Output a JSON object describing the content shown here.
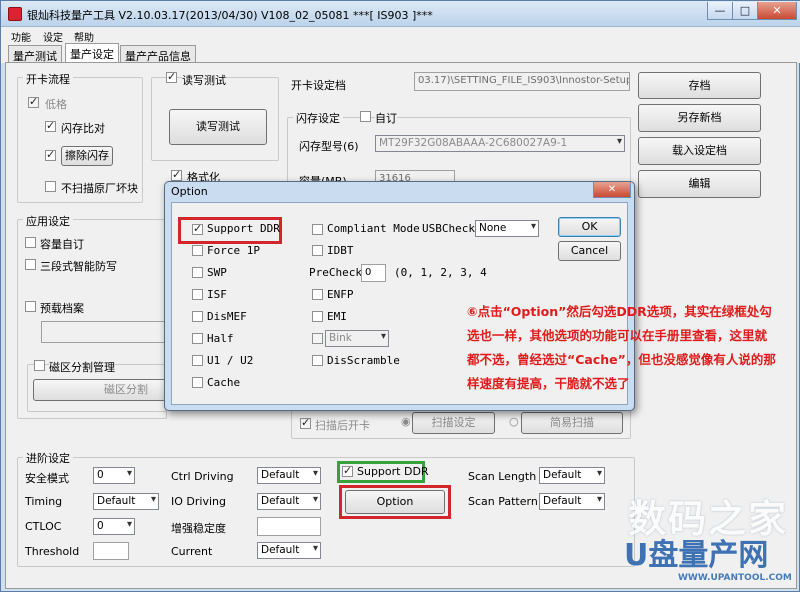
{
  "window": {
    "title": "银灿科技量产工具 V2.10.03.17(2013/04/30)    V108_02_05081              ***[ IS903 ]***",
    "min": "—",
    "max": "□",
    "close": "✕"
  },
  "menu": [
    "功能",
    "设定",
    "帮助"
  ],
  "tabs": [
    "量产测试",
    "量产设定",
    "量产产品信息"
  ],
  "card_flow": {
    "title": "开卡流程",
    "low_format": "低格",
    "flash_compare": "闪存比对",
    "erase_flash": "擦除闪存",
    "no_scan_bad": "不扫描原厂坏块"
  },
  "rw_test": {
    "title": "读写测试",
    "button": "读写测试"
  },
  "format": {
    "title": "格式化"
  },
  "settings_file": {
    "label": "开卡设定档",
    "value": "03.17)\\SETTING_FILE_IS903\\Innostor-Setup.ini"
  },
  "right_buttons": [
    "存档",
    "另存新档",
    "载入设定档",
    "编辑"
  ],
  "flash_settings": {
    "title": "闪存设定",
    "custom": "自订",
    "model_label": "闪存型号(6)",
    "model_value": "MT29F32G08ABAAA-2C680027A9-1",
    "capacity_label": "容量(MB)",
    "capacity_value": "31616"
  },
  "app_settings": {
    "title": "应用设定",
    "capacity_custom": "容量自订",
    "three_stage": "三段式智能防写",
    "preload": "预载档案",
    "partition_title": "磁区分割管理",
    "partition_button": "磁区分割"
  },
  "scan": {
    "scan_after": "扫描后开卡",
    "scan_settings": "扫描设定",
    "simple_scan": "简易扫描"
  },
  "advanced": {
    "title": "进阶设定",
    "safe_mode": {
      "label": "安全模式",
      "value": "0"
    },
    "timing": {
      "label": "Timing",
      "value": "Default"
    },
    "ctloc": {
      "label": "CTLOC",
      "value": "0"
    },
    "threshold": {
      "label": "Threshold",
      "value": ""
    },
    "ctrl_driving": {
      "label": "Ctrl Driving",
      "value": "Default"
    },
    "io_driving": {
      "label": "IO Driving",
      "value": "Default"
    },
    "stability": {
      "label": "增强稳定度",
      "value": ""
    },
    "current": {
      "label": "Current",
      "value": "Default"
    },
    "support_ddr": "Support DDR",
    "option_button": "Option",
    "scan_length": {
      "label": "Scan Length",
      "value": "Default"
    },
    "scan_pattern": {
      "label": "Scan Pattern",
      "value": "Default"
    }
  },
  "dialog": {
    "title": "Option",
    "close": "✕",
    "col1": [
      "Support DDR",
      "Force 1P",
      "SWP",
      "ISF",
      "DisMEF",
      "Half",
      "U1 / U2",
      "Cache"
    ],
    "compliant_mode": "Compliant Mode",
    "usbcheck_label": "USBCheck",
    "usbcheck_value": "None",
    "idbt": "IDBT",
    "precheck_label": "PreCheck",
    "precheck_value": "0",
    "precheck_hint": "(0, 1, 2, 3, 4",
    "enfp": "ENFP",
    "emi": "EMI",
    "emi_select": "Bink",
    "discramble": "DisScramble",
    "ok": "OK",
    "cancel": "Cancel"
  },
  "annotation": "⑥点击“Option”然后勾选DDR选项，其实在绿框处勾选也一样，其他选项的功能可以在手册里查看，这里就都不选，曾经选过“Cache”，但也没感觉像有人说的那样速度有提高，干脆就不选了",
  "watermark": {
    "line1": "数码之家",
    "line2": "U盘量产网",
    "line3": "WWW.UPANTOOL.COM"
  },
  "colors": {
    "red": "#d2262c",
    "green": "#36a33a",
    "title_bg": "#cfdfee"
  }
}
